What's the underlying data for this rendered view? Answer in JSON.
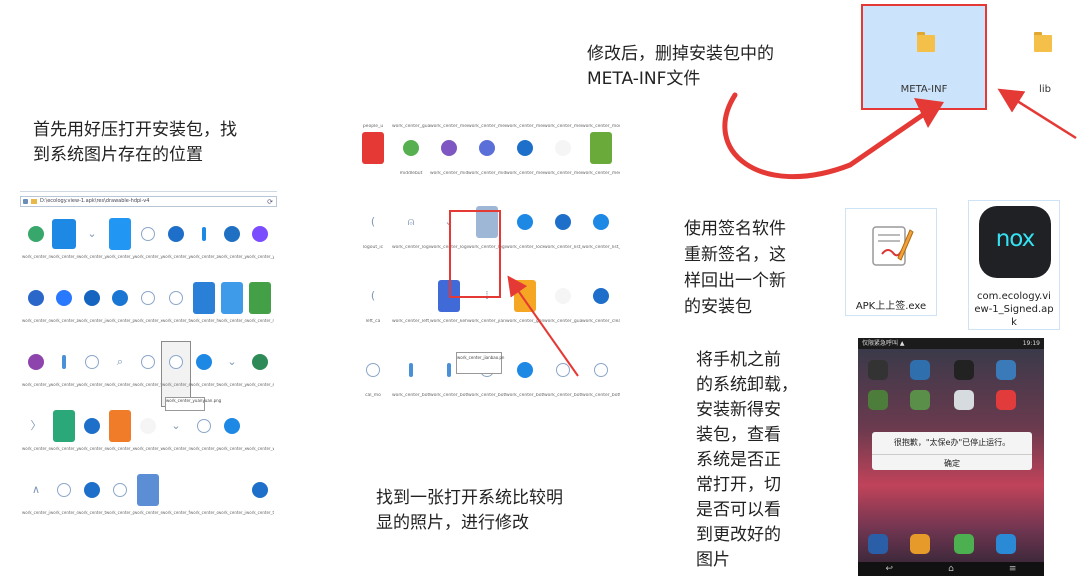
{
  "captions": {
    "step1": [
      "首先用好压打开安装包，找",
      "到系统图片存在的位置"
    ],
    "step2": [
      "找到一张打开系统比较明",
      "显的照片，进行修改"
    ],
    "step3": [
      "修改后，删掉安装包中的",
      "META-INF文件"
    ],
    "step4": [
      "使用签名软件",
      "重新签名，这",
      "样回出一个新",
      "的安装包"
    ],
    "step5": [
      "将手机之前",
      "的系统卸载，",
      "安装新得安",
      "装包，查看",
      "系统是否正",
      "常打开，切",
      "是否可以看",
      "到更改好的",
      "图片"
    ]
  },
  "archive_window": {
    "address_path": "D:\\ecology.view-1.apk\\res\\drawable-hdpi-v4",
    "rows": [
      [
        "work_center_renlu",
        "work_center_sousuo",
        "work_center_yuangong",
        "work_center_yunpan",
        "work_center_yuanyuan",
        "work_center_yuanggong",
        "work_center_zhiqu",
        "work_center_yuanq",
        "work_center_yue"
      ],
      [
        "work_center_dingdan",
        "work_center_ziyuan",
        "work_center_jiesuo",
        "work_center_piyue",
        "work_center_xinxi",
        "work_center_tongxun",
        "work_center_huiyi",
        "work_center_dingwei",
        "work_center_rili"
      ],
      [
        "work_center_yuanyuan",
        "work_center_yuyin",
        "work_center_renwu",
        "work_center_sousuo",
        "work_center_tixing",
        "work_center_shijian",
        "work_center_tongzhi",
        "work_center_yunpan",
        "work_center_shouye"
      ],
      [
        "work_center_shijian",
        "work_center_yaoqing",
        "work_center_shenpi",
        "work_center_xiaoxi",
        "work_center_wendang",
        "work_center_renwu",
        "work_center_gengduo",
        "work_center_xinxi",
        "work_center_wode"
      ],
      [
        "work_center_juzi",
        "work_center_dianhua",
        "work_center_tongxun",
        "work_center_guanli",
        "work_center_shuju",
        "work_center_fenxiang",
        "work_center_caiwu",
        "work_center_juese",
        "work_center_tongji"
      ]
    ],
    "tooltip": "work_center_yuanyuan.png"
  },
  "edit_window": {
    "top_labels": [
      "people_u",
      "work_center_guanzhu",
      "work_center_menu",
      "work_center_menu_wb",
      "work_center_menu_yuan",
      "work_center_menu_tx",
      "work_center_module"
    ],
    "rows": [
      [
        "",
        "middlebut",
        "work_center_middle",
        "work_center_middle",
        "work_center_menu_c",
        "work_center_menu_l",
        "work_center_meeting"
      ],
      [
        "logout_ic",
        "work_center_login_u",
        "work_center_login",
        "work_center_login_com.png",
        "work_center_lock",
        "work_center_list_sen",
        "work_center_list_u"
      ],
      [
        "left_ca",
        "work_center_left_top",
        "work_center_kehu",
        "work_center_jianbao",
        "work_center_gongga",
        "work_center_guan",
        "work_center_clear"
      ],
      [
        "cal_mo",
        "work_center_bottom",
        "work_center_bottom_",
        "work_center_bottom_",
        "work_center_bottom_",
        "work_center_bottom_",
        "work_center_bottom_"
      ]
    ],
    "selected_file": "work_center_login_com.png",
    "tooltip": "work_center_jianbao.pn"
  },
  "folders": [
    {
      "name": "META-INF",
      "selected": true
    },
    {
      "name": "lib",
      "selected": false
    }
  ],
  "files": {
    "exe": "APK上上签.exe",
    "apk": [
      "com.ecology.vi",
      "ew-1_Signed.ap",
      "k"
    ]
  },
  "nox_logo_text": "nox",
  "phone": {
    "status_left": "仅限紧急呼叫 ▲",
    "status_right": "19:19",
    "dialog_message": "很抱歉，\"太保e办\"已停止运行。",
    "dialog_button": "确定"
  },
  "colors": {
    "highlight_red": "#e53935",
    "selection_blue": "#cce4fb",
    "folder_yellow": "#f5c04a",
    "nox_cyan": "#35e2f2"
  }
}
